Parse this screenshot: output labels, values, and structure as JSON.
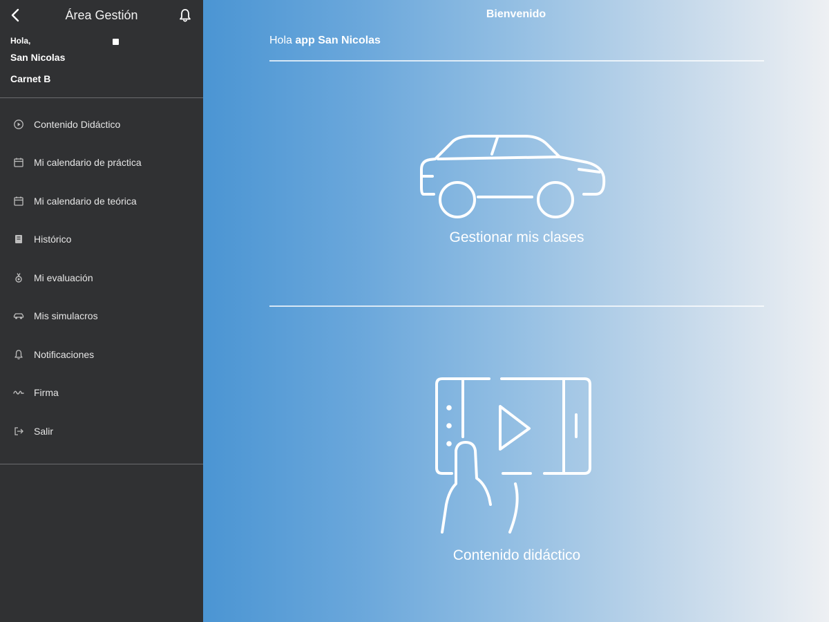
{
  "sidebar": {
    "title": "Área Gestión",
    "greeting": "Hola,",
    "user_name": "San Nicolas",
    "license": "Carnet B",
    "items": [
      {
        "label": "Contenido Didáctico",
        "icon": "play-circle-icon"
      },
      {
        "label": "Mi calendario de práctica",
        "icon": "calendar-icon"
      },
      {
        "label": "Mi calendario de teórica",
        "icon": "calendar-icon"
      },
      {
        "label": "Histórico",
        "icon": "book-icon"
      },
      {
        "label": "Mi evaluación",
        "icon": "medal-icon"
      },
      {
        "label": "Mis simulacros",
        "icon": "car-icon"
      },
      {
        "label": "Notificaciones",
        "icon": "bell-icon"
      },
      {
        "label": "Firma",
        "icon": "signature-icon"
      },
      {
        "label": "Salir",
        "icon": "logout-icon"
      }
    ]
  },
  "main": {
    "title": "Bienvenido",
    "hola_prefix": "Hola",
    "hola_name": "app San Nicolas",
    "cards": [
      {
        "label": "Gestionar mis clases",
        "icon": "car-icon"
      },
      {
        "label": "Contenido didáctico",
        "icon": "tablet-video-icon"
      }
    ]
  },
  "colors": {
    "sidebar_bg": "#303133",
    "gradient_start": "#4b95d3",
    "gradient_end": "#eef0f3"
  }
}
